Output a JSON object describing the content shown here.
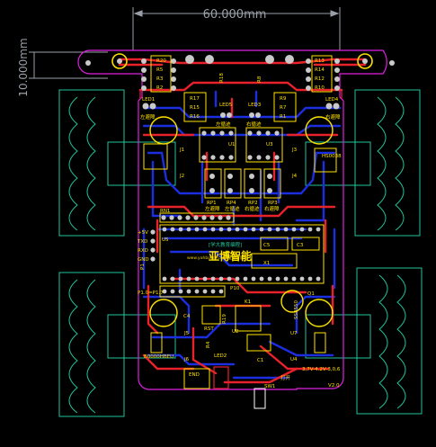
{
  "dimensions": {
    "width_label": "60.000mm",
    "height_label": "10.000mm"
  },
  "colors": {
    "background": "#000000",
    "top_copper": "#e8222b",
    "bottom_copper": "#1b2ee0",
    "silkscreen": "#ffe200",
    "outline": "#e020e0",
    "mechanical": "#21c59b",
    "pad": "#c9c9c9",
    "dimension": "#9aa0a8"
  },
  "labels": {
    "resistors_left": [
      "R20",
      "R5",
      "R3",
      "R2"
    ],
    "resistors_right": [
      "R13",
      "R14",
      "R12",
      "R10"
    ],
    "resistors_center_left": [
      "R17",
      "R15",
      "R16"
    ],
    "resistors_center_right": [
      "R9",
      "R7",
      "R1"
    ],
    "center_vertical": [
      "R18",
      "R8"
    ],
    "led_left": "LED1",
    "led_right": "LED4",
    "led_mid_left": "LED5",
    "led_mid_right": "LED3",
    "caption_left": "左避障",
    "caption_right": "右避障",
    "caption_mid_left": "左循迹",
    "caption_mid_right": "右循迹",
    "u1": "U1",
    "u3": "U3",
    "j2": "J2",
    "j3": "J3",
    "j1": "J1",
    "j4": "J4",
    "rp1": "RP1",
    "rp2": "RP2",
    "rp3": "RP3",
    "rp4": "RP4",
    "pot_captions": [
      "左避障",
      "左循迹",
      "右循迹",
      "右避障"
    ],
    "rn1": "RN1",
    "u5": "U5",
    "side_pins": [
      "+5V",
      "TXD",
      "RXD",
      "GND"
    ],
    "brand_small": "[学大教育编程]",
    "brand_main": "亚博智能",
    "brand_sub": "www.yahboom.com 亚博智能",
    "c5": "C5",
    "c3": "C3",
    "x1": "X1",
    "p1": "P1",
    "p10": "P10",
    "p1_p17": "P1.0=P1.7",
    "q1": "Q1",
    "ss8550": "SS8550",
    "c4": "C4",
    "rst": "RST",
    "k1": "K1",
    "r19": "R19",
    "j5": "J5",
    "j6": "J6",
    "u2": "U2",
    "u7": "U7",
    "u4": "U4",
    "c1": "C1",
    "r4": "R4",
    "led2": "LED2",
    "end": "END",
    "sw1": "SW1",
    "open": "打开",
    "ir_label": "HS0038",
    "bottom_left_label": "B0000HBEU",
    "bottom_right_label": "3,7V-4.2V-3,0,6",
    "version": "V2.0"
  }
}
